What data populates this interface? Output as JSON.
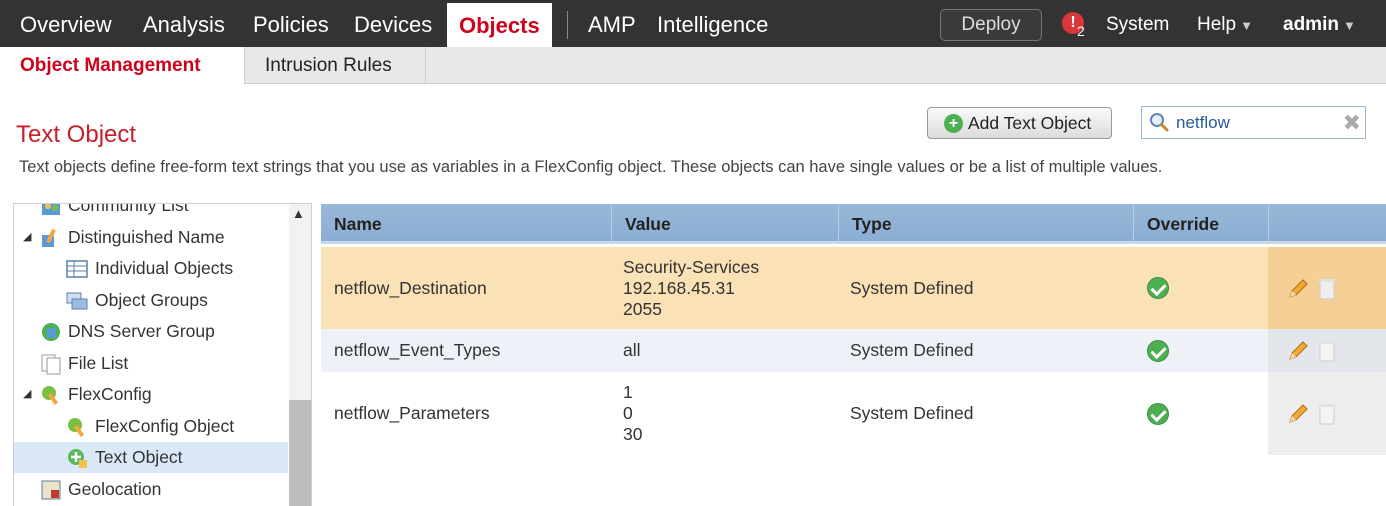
{
  "nav": {
    "items": [
      "Overview",
      "Analysis",
      "Policies",
      "Devices",
      "Objects",
      "AMP",
      "Intelligence"
    ],
    "deploy": "Deploy",
    "alert_icon": "!",
    "alert_count": "2",
    "system": "System",
    "help": "Help",
    "user": "admin",
    "caret": "▼"
  },
  "subnav": {
    "tabs": [
      "Object Management",
      "Intrusion Rules"
    ]
  },
  "page": {
    "title": "Text Object",
    "description": "Text objects define free-form text strings that you use as variables in a FlexConfig object. These objects can have single values or be a list of multiple values.",
    "add_button": "Add Text Object",
    "search_value": "netflow",
    "clear_glyph": "✖"
  },
  "tree": {
    "items": [
      {
        "label": "Community List",
        "icon": "community-list-icon"
      },
      {
        "label": "Distinguished Name",
        "icon": "distinguished-name-icon",
        "expanded": true
      },
      {
        "label": "Individual Objects",
        "icon": "individual-objects-icon"
      },
      {
        "label": "Object Groups",
        "icon": "object-groups-icon"
      },
      {
        "label": "DNS Server Group",
        "icon": "dns-server-group-icon"
      },
      {
        "label": "File List",
        "icon": "file-list-icon"
      },
      {
        "label": "FlexConfig",
        "icon": "flexconfig-icon",
        "expanded": true
      },
      {
        "label": "FlexConfig Object",
        "icon": "flexconfig-object-icon"
      },
      {
        "label": "Text Object",
        "icon": "text-object-icon",
        "selected": true
      },
      {
        "label": "Geolocation",
        "icon": "geolocation-icon"
      }
    ],
    "expand_glyph": "◢",
    "scroll_up_glyph": "▲"
  },
  "table": {
    "headers": [
      "Name",
      "Value",
      "Type",
      "Override"
    ],
    "rows": [
      {
        "name": "netflow_Destination",
        "values": [
          "Security-Services",
          "192.168.45.31",
          "2055"
        ],
        "type": "System Defined",
        "override": true,
        "highlight": true
      },
      {
        "name": "netflow_Event_Types",
        "values": [
          "all"
        ],
        "type": "System Defined",
        "override": true
      },
      {
        "name": "netflow_Parameters",
        "values": [
          "1",
          "0",
          "30"
        ],
        "type": "System Defined",
        "override": true
      }
    ]
  },
  "colors": {
    "accent_red": "#d0021b",
    "highlight_row": "#fbe1b6",
    "header_blue": "#8aaed3"
  }
}
